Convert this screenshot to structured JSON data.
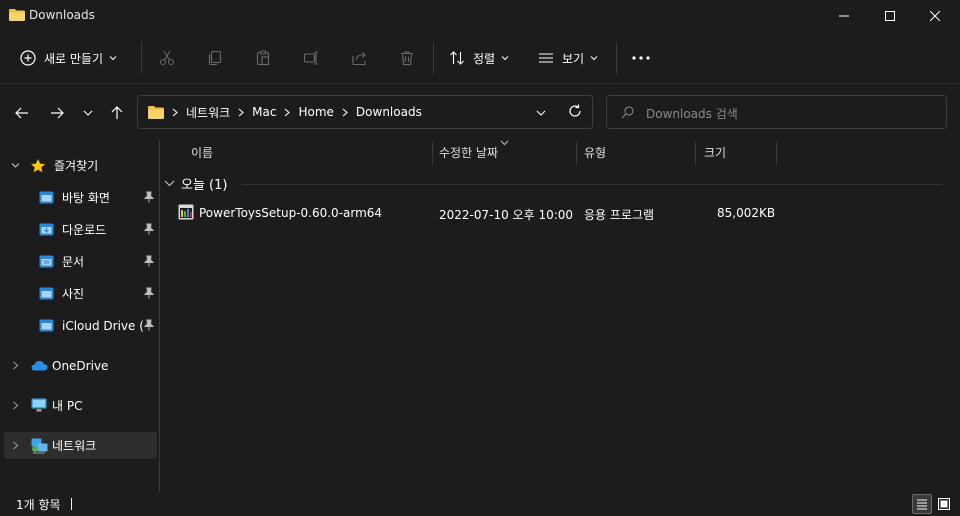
{
  "window": {
    "title": "Downloads"
  },
  "toolbar": {
    "new_label": "새로 만들기",
    "sort_label": "정렬",
    "view_label": "보기",
    "icons": [
      "cut-icon",
      "copy-icon",
      "paste-icon",
      "rename-icon",
      "share-icon",
      "delete-icon"
    ]
  },
  "address": {
    "crumbs": [
      "네트워크",
      "Mac",
      "Home",
      "Downloads"
    ]
  },
  "search": {
    "placeholder": "Downloads 검색"
  },
  "sidebar": {
    "quick_access": {
      "label": "즐겨찾기"
    },
    "quick_items": [
      {
        "label": "바탕 화면"
      },
      {
        "label": "다운로드"
      },
      {
        "label": "문서"
      },
      {
        "label": "사진"
      },
      {
        "label": "iCloud Drive (M"
      }
    ],
    "onedrive": {
      "label": "OneDrive"
    },
    "this_pc": {
      "label": "내 PC"
    },
    "network": {
      "label": "네트워크"
    }
  },
  "columns": {
    "name": "이름",
    "modified": "수정한 날짜",
    "type": "유형",
    "size": "크기"
  },
  "group": {
    "label": "오늘 (1)"
  },
  "files": [
    {
      "name": "PowerToysSetup-0.60.0-arm64",
      "modified": "2022-07-10 오후 10:00",
      "type": "응용 프로그램",
      "size": "85,002KB"
    }
  ],
  "status": {
    "count": "1개 항목"
  },
  "colors": {
    "background": "#1c1c1c",
    "folder": "#f4c042",
    "star": "#f5c518",
    "onedrive": "#2e8fe0",
    "selected": "#2d2d2d"
  }
}
